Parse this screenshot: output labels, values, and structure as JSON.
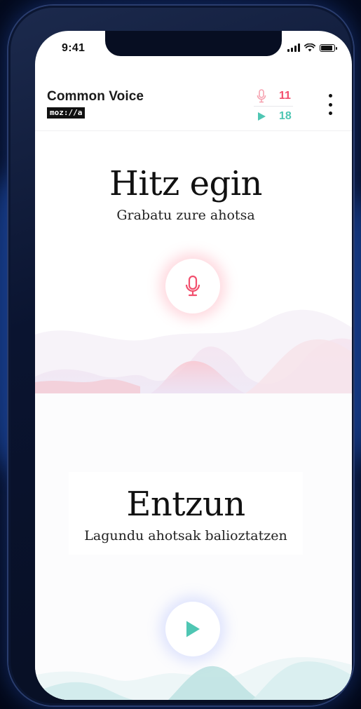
{
  "status_bar": {
    "time": "9:41",
    "signal_icon": "signal-icon",
    "wifi_icon": "wifi-icon",
    "battery_icon": "battery-icon"
  },
  "header": {
    "app_title": "Common Voice",
    "brand_logo": "moz://a",
    "stats": {
      "recorded_count": "11",
      "recorded_icon": "mic-icon",
      "recorded_color": "#f2506e",
      "validated_count": "18",
      "validated_icon": "play-icon",
      "validated_color": "#4fc6b3"
    },
    "menu_icon": "kebab-menu-icon"
  },
  "speak": {
    "title": "Hitz egin",
    "subtitle": "Grabatu zure ahotsa",
    "button_icon": "mic-icon",
    "accent": "#f2506e"
  },
  "listen": {
    "title": "Entzun",
    "subtitle": "Lagundu ahotsak balioztatzen",
    "button_icon": "play-icon",
    "accent": "#4fc6b3"
  }
}
